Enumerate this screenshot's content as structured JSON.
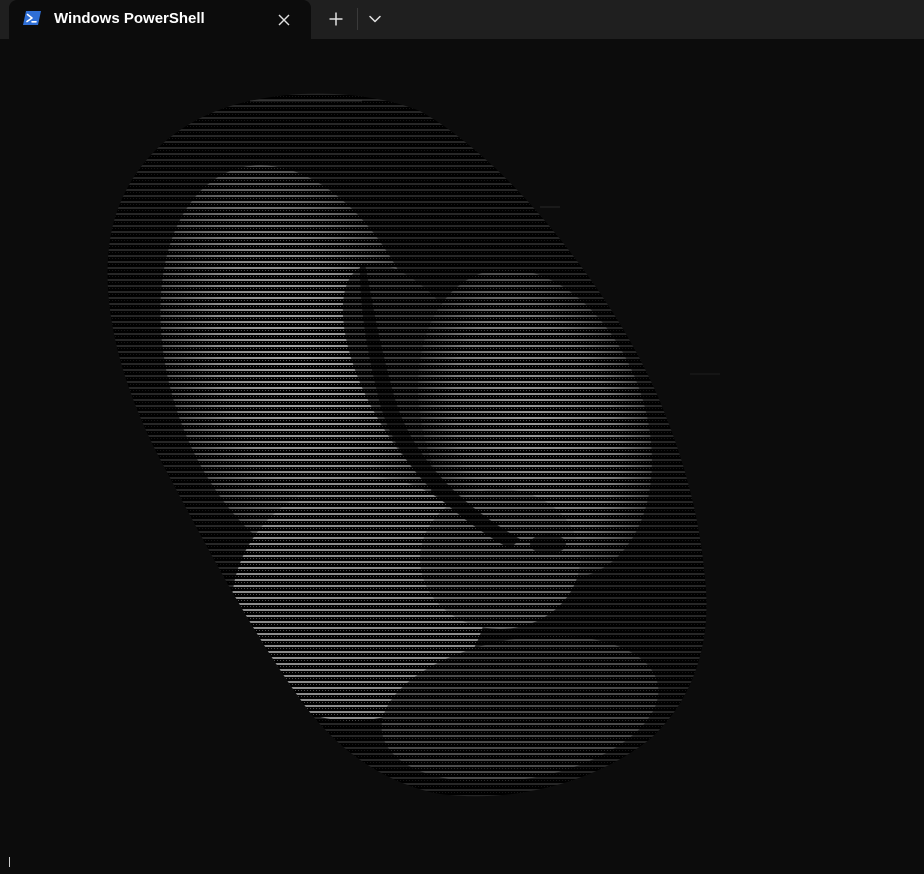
{
  "window": {
    "tab": {
      "title": "Windows PowerShell",
      "icon": "powershell-icon"
    },
    "buttons": {
      "close_icon": "close-icon",
      "new_tab_icon": "plus-icon",
      "dropdown_icon": "chevron-down-icon"
    }
  },
  "terminal": {
    "content": "ascii-art-render",
    "colors": {
      "background": "#0c0c0c",
      "foreground": "#cccccc",
      "titlebar": "#1f1f1f",
      "icon_accent": "#2f6fd6"
    }
  }
}
